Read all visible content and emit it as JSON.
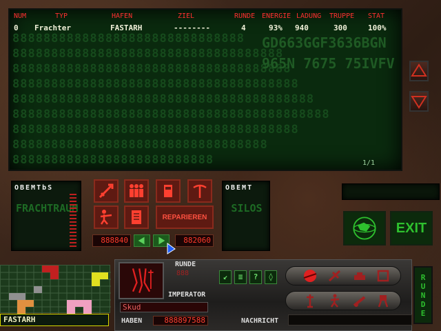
{
  "table": {
    "headers": [
      "NUM",
      "TYP",
      "HAFEN",
      "ZIEL",
      "RUNDE",
      "ENERGIE",
      "LADUNG",
      "TRUPPE",
      "STAT"
    ],
    "row": [
      "0",
      "Frachter",
      "FASTARH",
      "--------",
      "4",
      "93%",
      "940",
      "300",
      "100%"
    ],
    "page_indicator": "1/1",
    "colors": {
      "header": "#ff3030",
      "cell": "#f0f0d8",
      "screen": "#0a2a0e"
    }
  },
  "background_text": {
    "code_line_1": "GD663GGF3636BGN",
    "code_line_2": "965N 7675   75IVFV"
  },
  "left_panel": {
    "title": "OBEMTbS",
    "word": "FRACHTRAUM"
  },
  "center_panel": {
    "icons": [
      "missile-icon",
      "troops-icon",
      "fuel-icon",
      "pickaxe-icon",
      "soldier-icon",
      "document-icon"
    ],
    "repair_label": "REPARIEREN",
    "counter_left": "888840",
    "counter_right": "882060"
  },
  "right_panel": {
    "title": "OBEMT",
    "word": "SILOS"
  },
  "exit_label": "EXIT",
  "bottom": {
    "location": "FASTARH",
    "runde_label": "RUNDE",
    "runde_value": "888",
    "rank_label": "IMPERATOR",
    "player_name": "Skud",
    "haben_label": "HABEN",
    "haben_value": "888897588",
    "nachricht_label": "NACHRICHT",
    "tool_buttons": [
      "↙",
      "≡",
      "?",
      "◊"
    ],
    "runde_vertical": [
      "R",
      "U",
      "N",
      "D",
      "E"
    ]
  }
}
